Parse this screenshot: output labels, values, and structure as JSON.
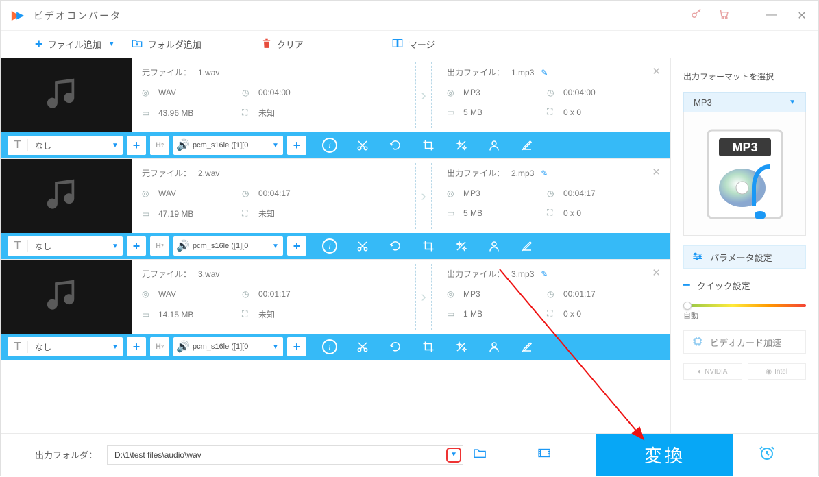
{
  "app": {
    "title": "ビデオコンバータ"
  },
  "toolbar": {
    "add_file": "ファイル追加",
    "add_folder": "フォルダ追加",
    "clear": "クリア",
    "merge": "マージ"
  },
  "files": [
    {
      "source_label": "元ファイル：",
      "source_name": "1.wav",
      "src_format": "WAV",
      "src_duration": "00:04:00",
      "src_size": "43.96 MB",
      "src_resolution": "未知",
      "output_label": "出力ファイル：",
      "output_name": "1.mp3",
      "out_format": "MP3",
      "out_duration": "00:04:00",
      "out_size": "5 MB",
      "out_resolution": "0 x 0",
      "subtitle": "なし",
      "audio_codec": "pcm_s16le ([1][0"
    },
    {
      "source_label": "元ファイル：",
      "source_name": "2.wav",
      "src_format": "WAV",
      "src_duration": "00:04:17",
      "src_size": "47.19 MB",
      "src_resolution": "未知",
      "output_label": "出力ファイル：",
      "output_name": "2.mp3",
      "out_format": "MP3",
      "out_duration": "00:04:17",
      "out_size": "5 MB",
      "out_resolution": "0 x 0",
      "subtitle": "なし",
      "audio_codec": "pcm_s16le ([1][0"
    },
    {
      "source_label": "元ファイル：",
      "source_name": "3.wav",
      "src_format": "WAV",
      "src_duration": "00:01:17",
      "src_size": "14.15 MB",
      "src_resolution": "未知",
      "output_label": "出力ファイル：",
      "output_name": "3.mp3",
      "out_format": "MP3",
      "out_duration": "00:01:17",
      "out_size": "1 MB",
      "out_resolution": "0 x 0",
      "subtitle": "なし",
      "audio_codec": "pcm_s16le ([1][0"
    }
  ],
  "sidebar": {
    "title": "出力フォーマットを選択",
    "format": "MP3",
    "param_settings": "パラメータ設定",
    "quick_settings": "クイック設定",
    "slider_label": "自動",
    "gpu_accel": "ビデオカード加速",
    "gpu_nvidia": "NVIDIA",
    "gpu_intel": "Intel"
  },
  "bottom": {
    "output_folder_label": "出力フォルダ：",
    "output_path": "D:\\1\\test files\\audio\\wav",
    "convert": "変換"
  }
}
